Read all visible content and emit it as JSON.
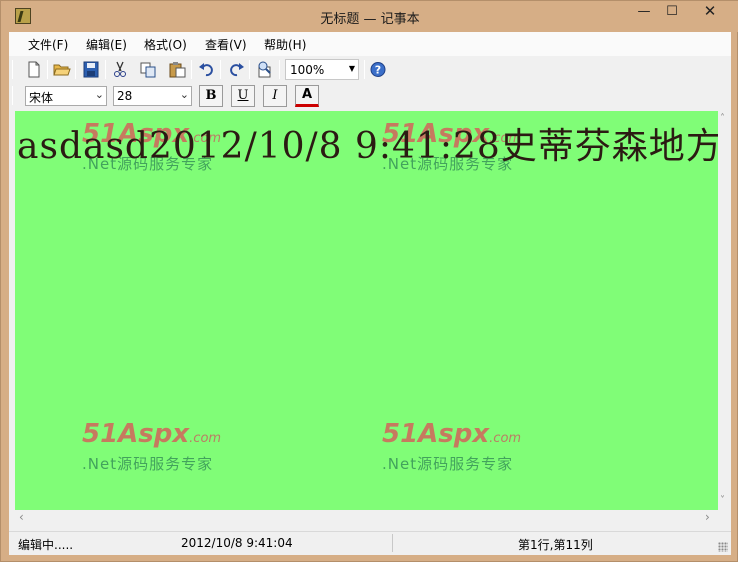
{
  "window": {
    "title": "无标题 — 记事本",
    "minimize_glyph": "—",
    "maximize_glyph": "☐",
    "close_glyph": "✕"
  },
  "menubar": {
    "items": [
      {
        "label": "文件(F)"
      },
      {
        "label": "编辑(E)"
      },
      {
        "label": "格式(O)"
      },
      {
        "label": "查看(V)"
      },
      {
        "label": "帮助(H)"
      }
    ]
  },
  "toolbar": {
    "icons": [
      "new-document-icon",
      "open-folder-icon",
      "save-icon",
      "cut-icon",
      "copy-icon",
      "paste-icon",
      "undo-icon",
      "redo-icon",
      "find-icon",
      "help-icon"
    ],
    "zoom": "100%"
  },
  "format_bar": {
    "font_name": "宋体",
    "font_size": "28",
    "bold_label": "B",
    "underline_label": "U",
    "italic_label": "I",
    "color_label": "A",
    "text_color": "#cc0000"
  },
  "editor": {
    "text": "asdasd2012/10/8 9:41:28史蒂芬森地方",
    "background": "#80fd77",
    "watermark_logo": "51Aspx",
    "watermark_domain": ".com",
    "watermark_subtitle": ".Net源码服务专家"
  },
  "statusbar": {
    "mode": "编辑中.....",
    "timestamp": "2012/10/8 9:41:04",
    "position": "第1行,第11列"
  }
}
